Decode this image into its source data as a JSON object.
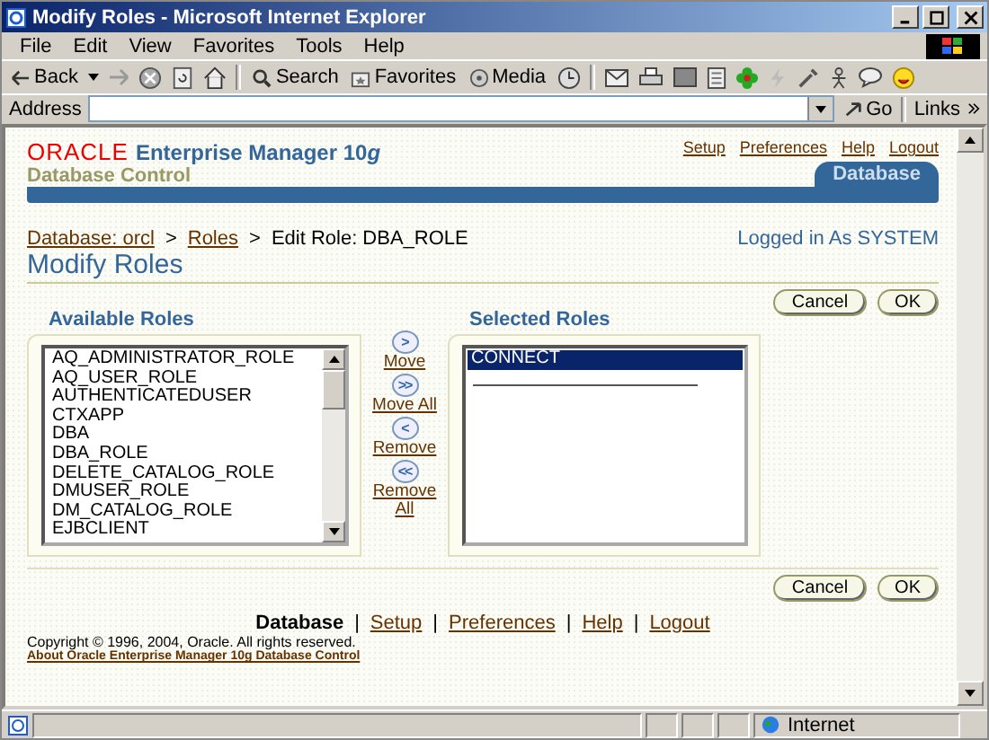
{
  "window": {
    "title": "Modify Roles - Microsoft Internet Explorer"
  },
  "menu": [
    "File",
    "Edit",
    "View",
    "Favorites",
    "Tools",
    "Help"
  ],
  "toolbar": {
    "back": "Back",
    "search": "Search",
    "favorites": "Favorites",
    "media": "Media"
  },
  "address_bar": {
    "label": "Address",
    "go": "Go",
    "links": "Links"
  },
  "header": {
    "brand": "ORACLE",
    "product": "Enterprise Manager 10",
    "product_suffix": "g",
    "subtitle": "Database Control",
    "global_links": [
      "Setup",
      "Preferences",
      "Help",
      "Logout"
    ],
    "tab": "Database"
  },
  "breadcrumb": [
    {
      "label": "Database: orcl",
      "kind": "link"
    },
    {
      "label": "Roles",
      "kind": "link"
    },
    {
      "label": "Edit Role: DBA_ROLE",
      "kind": "text"
    }
  ],
  "breadcrumb_separators": [
    ">",
    ">"
  ],
  "logged_in": "Logged in As SYSTEM",
  "page_title": "Modify Roles",
  "buttons": [
    "Cancel",
    "OK"
  ],
  "available_roles": {
    "heading": "Available Roles",
    "items": [
      {
        "label": "AQ_ADMINISTRATOR_ROLE",
        "selected": false
      },
      {
        "label": "AQ_USER_ROLE",
        "selected": false
      },
      {
        "label": "AUTHENTICATEDUSER",
        "selected": false
      },
      {
        "label": "CTXAPP",
        "selected": false
      },
      {
        "label": "DBA",
        "selected": false
      },
      {
        "label": "DBA_ROLE",
        "selected": false
      },
      {
        "label": "DELETE_CATALOG_ROLE",
        "selected": false
      },
      {
        "label": "DMUSER_ROLE",
        "selected": false
      },
      {
        "label": "DM_CATALOG_ROLE",
        "selected": false
      },
      {
        "label": "EJBCLIENT",
        "selected": false
      }
    ]
  },
  "shuttle": [
    {
      "glyph": ">",
      "label": "Move"
    },
    {
      "glyph": ">>",
      "label": "Move All"
    },
    {
      "glyph": "<",
      "label": "Remove"
    },
    {
      "glyph": "<<",
      "label": "Remove All"
    }
  ],
  "selected_roles": {
    "heading": "Selected Roles",
    "items": [
      {
        "label": "CONNECT",
        "selected": true
      }
    ]
  },
  "bottom_buttons": [
    "Cancel",
    "OK"
  ],
  "footer": {
    "links": [
      {
        "label": "Database",
        "kind": "current"
      },
      {
        "label": "Setup",
        "kind": "link"
      },
      {
        "label": "Preferences",
        "kind": "link"
      },
      {
        "label": "Help",
        "kind": "link"
      },
      {
        "label": "Logout",
        "kind": "link"
      }
    ],
    "separators": [
      "|",
      "|",
      "|",
      "|"
    ],
    "copyright": "Copyright © 1996, 2004, Oracle. All rights reserved.",
    "about": "About Oracle Enterprise Manager 10g Database Control"
  },
  "status_bar": {
    "zone": "Internet"
  }
}
